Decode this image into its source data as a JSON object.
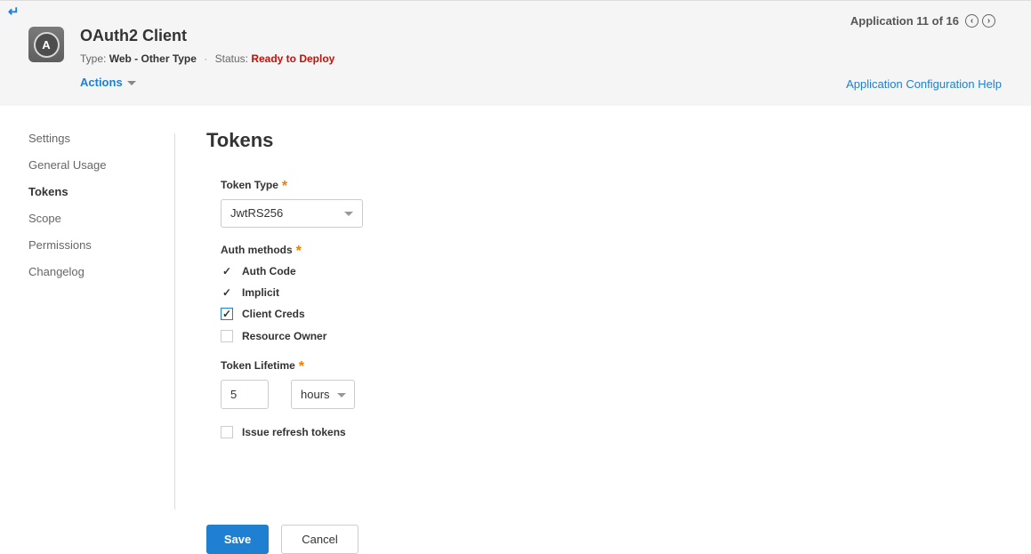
{
  "header": {
    "app_title": "OAuth2 Client",
    "type_label": "Type:",
    "type_value": "Web - Other Type",
    "separator": "·",
    "status_label": "Status:",
    "status_value": "Ready to Deploy",
    "actions_label": "Actions",
    "pager_text": "Application 11 of 16",
    "help_link": "Application Configuration Help",
    "app_icon_letter": "A"
  },
  "sidebar": {
    "items": [
      {
        "label": "Settings",
        "active": false
      },
      {
        "label": "General Usage",
        "active": false
      },
      {
        "label": "Tokens",
        "active": true
      },
      {
        "label": "Scope",
        "active": false
      },
      {
        "label": "Permissions",
        "active": false
      },
      {
        "label": "Changelog",
        "active": false
      }
    ]
  },
  "main": {
    "title": "Tokens",
    "token_type": {
      "label": "Token Type",
      "required_mark": "*",
      "value": "JwtRS256"
    },
    "auth_methods": {
      "label": "Auth methods",
      "required_mark": "*",
      "options": [
        {
          "label": "Auth Code",
          "checked": true
        },
        {
          "label": "Implicit",
          "checked": true
        },
        {
          "label": "Client Creds",
          "checked": true
        },
        {
          "label": "Resource Owner",
          "checked": false
        }
      ]
    },
    "token_lifetime": {
      "label": "Token Lifetime",
      "required_mark": "*",
      "value": "5",
      "unit": "hours"
    },
    "refresh": {
      "label": "Issue refresh tokens",
      "checked": false
    },
    "save_label": "Save",
    "cancel_label": "Cancel"
  },
  "colors": {
    "accent": "#1f7fd0",
    "status_red": "#c0120a",
    "required_orange": "#f57c00",
    "header_bg": "#f5f5f5"
  },
  "icons": {
    "back": "back-arrow-icon",
    "app": "app-logo-icon",
    "prev": "chevron-left-circle-icon",
    "next": "chevron-right-circle-icon",
    "check": "checkmark-icon"
  }
}
